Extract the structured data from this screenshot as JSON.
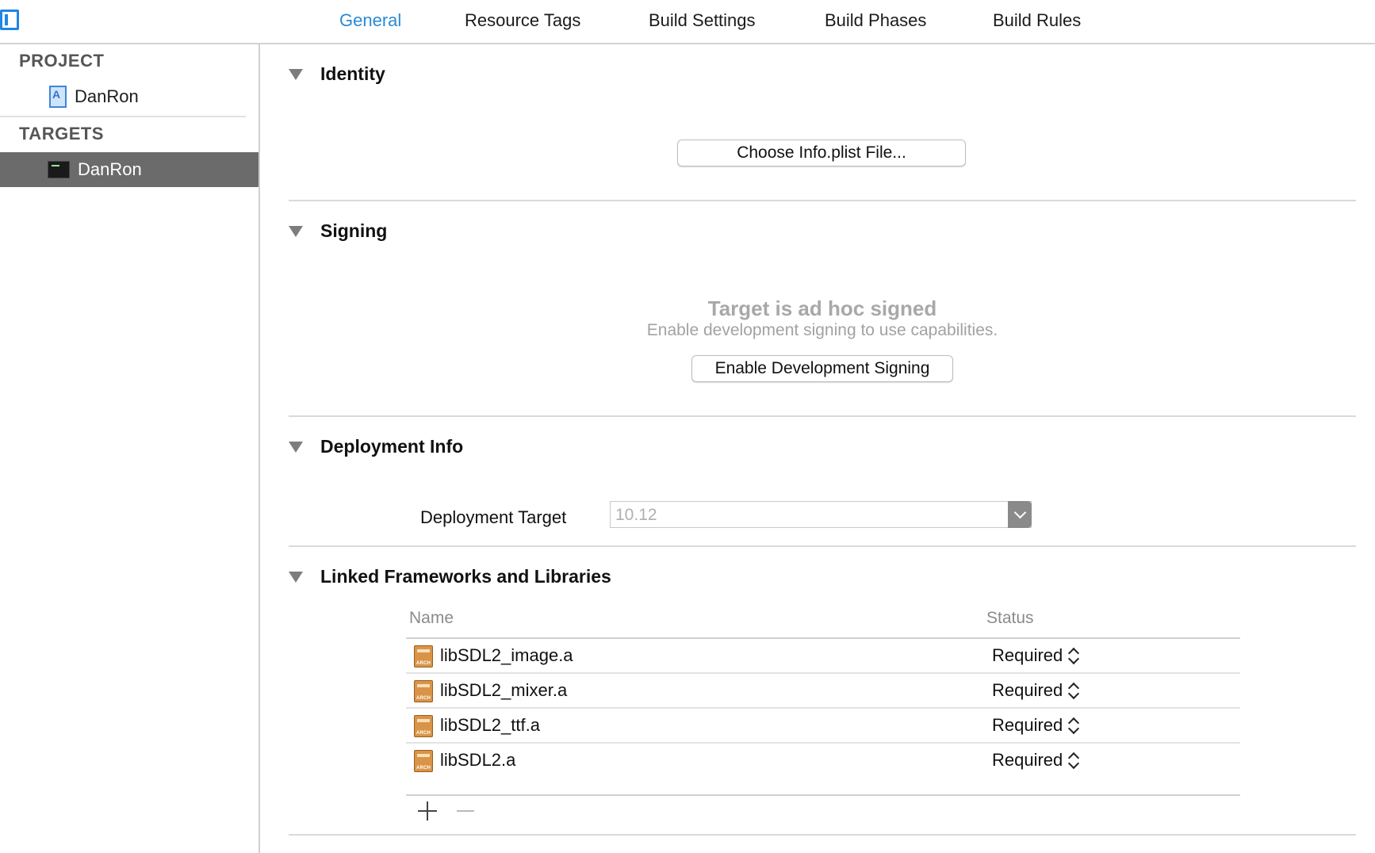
{
  "tabs": [
    {
      "label": "General",
      "active": true
    },
    {
      "label": "Resource Tags",
      "active": false
    },
    {
      "label": "Build Settings",
      "active": false
    },
    {
      "label": "Build Phases",
      "active": false
    },
    {
      "label": "Build Rules",
      "active": false
    }
  ],
  "sidebar": {
    "project_header": "PROJECT",
    "project_item": "DanRon",
    "targets_header": "TARGETS",
    "target_item": "DanRon"
  },
  "identity": {
    "title": "Identity",
    "choose_button": "Choose Info.plist File..."
  },
  "signing": {
    "title": "Signing",
    "status_title": "Target is ad hoc signed",
    "status_subtitle": "Enable development signing to use capabilities.",
    "enable_button": "Enable Development Signing"
  },
  "deployment": {
    "title": "Deployment Info",
    "target_label": "Deployment Target",
    "target_value": "10.12"
  },
  "linked": {
    "title": "Linked Frameworks and Libraries",
    "col_name": "Name",
    "col_status": "Status",
    "icon_text": "ARCH",
    "rows": [
      {
        "name": "libSDL2_image.a",
        "status": "Required"
      },
      {
        "name": "libSDL2_mixer.a",
        "status": "Required"
      },
      {
        "name": "libSDL2_ttf.a",
        "status": "Required"
      },
      {
        "name": "libSDL2.a",
        "status": "Required"
      }
    ]
  },
  "colors": {
    "accent": "#2a8ad4",
    "selection": "#6b6b6b"
  }
}
